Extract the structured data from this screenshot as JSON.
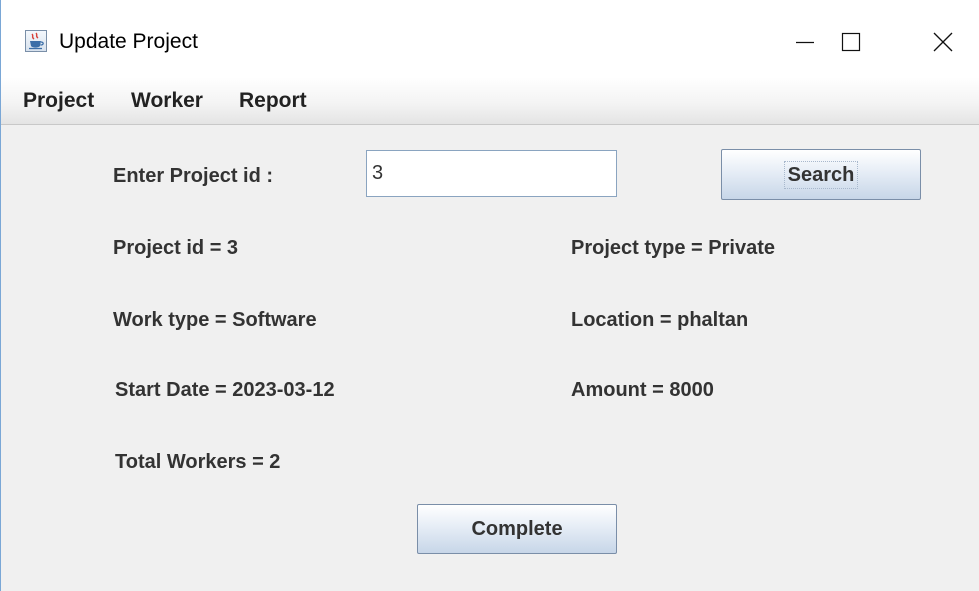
{
  "window": {
    "title": "Update Project",
    "app_icon": "java-cup-icon",
    "controls": {
      "minimize_icon": "minimize-icon",
      "maximize_icon": "maximize-icon",
      "close_icon": "close-icon"
    }
  },
  "menu": {
    "items": [
      {
        "label": "Project"
      },
      {
        "label": "Worker"
      },
      {
        "label": "Report"
      }
    ]
  },
  "search": {
    "label": "Enter Project id :",
    "value": "3",
    "button_label": "Search"
  },
  "details": {
    "project_id": "Project id = 3",
    "project_type": "Project type = Private",
    "work_type": "Work type = Software",
    "location": "Location = phaltan",
    "start_date": "Start Date = 2023-03-12",
    "amount": "Amount = 8000",
    "total_workers": "Total Workers = 2"
  },
  "actions": {
    "complete_label": "Complete"
  },
  "colors": {
    "background": "#f0f0f0",
    "text": "#333333",
    "button_border": "#7a8ea8",
    "input_border": "#8aa4c0",
    "window_border": "#7aa7d6"
  }
}
